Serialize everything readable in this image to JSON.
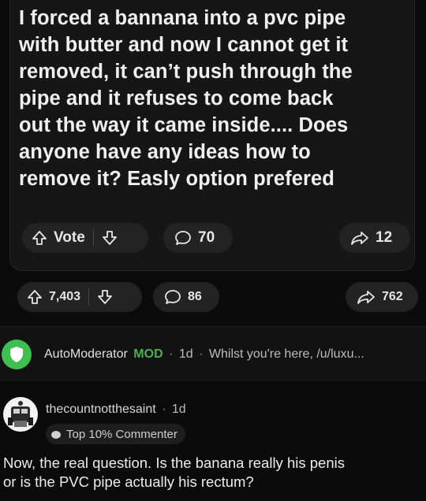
{
  "post": {
    "text": "I forced a bannana into a pvc pipe\nwith butter and now I cannot get it\nremoved, it can’t push through the\npipe and it refuses to come back\nout the way it came inside.... Does\nanyone have any ideas how to\nremove it? Easly option prefered",
    "vote_label": "Vote",
    "comment_count": "70",
    "share_count": "12"
  },
  "outer": {
    "vote_count": "7,403",
    "comment_count": "86",
    "share_count": "762"
  },
  "automod": {
    "username": "AutoModerator",
    "badge": "MOD",
    "dot1": "·",
    "age": "1d",
    "dot2": "·",
    "preview": "Whilst you're here, /u/luxu..."
  },
  "comment": {
    "username": "thecountnotthesaint",
    "dot": "·",
    "age": "1d",
    "flair": "Top 10% Commenter",
    "text": "Now, the real question. Is the banana really his penis\nor is the PVC pipe actually his rectum?"
  },
  "colors": {
    "automod_avatar": "#3fbf4f",
    "mod_badge": "#4caf50",
    "background": "#0b0b0b",
    "card": "#161616",
    "pill": "#232323"
  }
}
